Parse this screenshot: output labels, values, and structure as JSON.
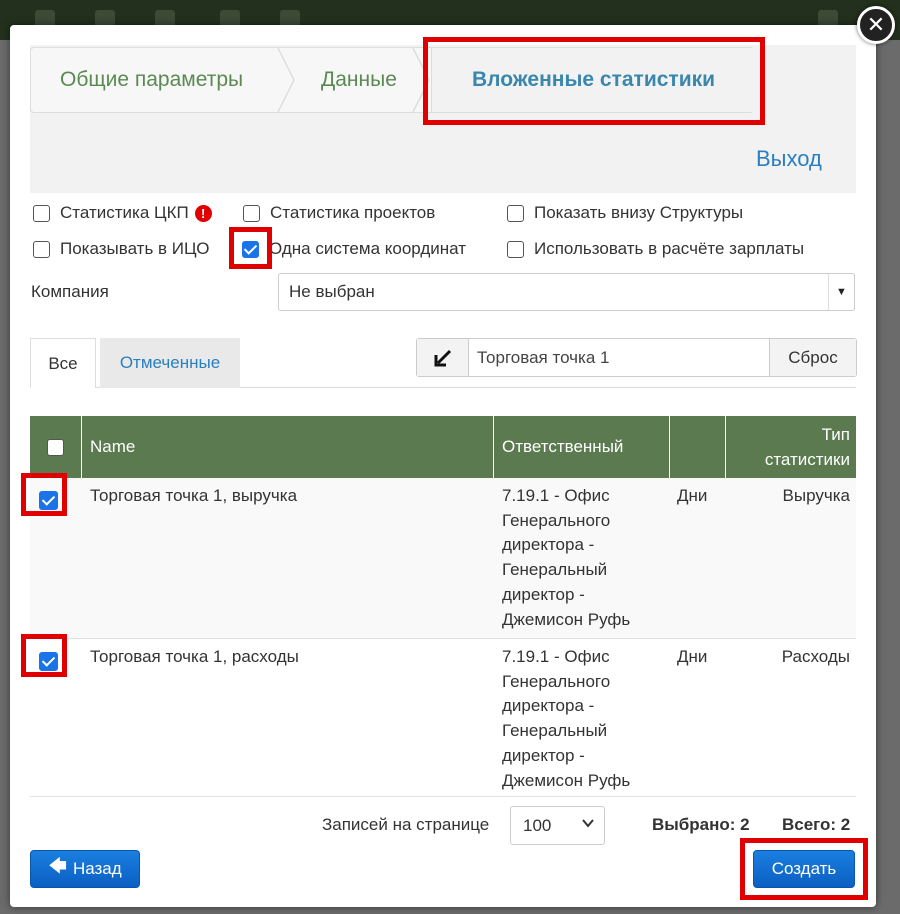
{
  "wizard": {
    "steps": [
      {
        "label": "Общие параметры"
      },
      {
        "label": "Данные"
      },
      {
        "label": "Вложенные статистики"
      }
    ],
    "exit_label": "Выход"
  },
  "options": {
    "stat_ckp": {
      "label": "Статистика ЦКП",
      "checked": false
    },
    "stat_projects": {
      "label": "Статистика проектов",
      "checked": false
    },
    "show_structure": {
      "label": "Показать внизу Структуры",
      "checked": false
    },
    "show_ico": {
      "label": "Показывать в ИЦО",
      "checked": false
    },
    "one_coords": {
      "label": "Одна система координат",
      "checked": true
    },
    "use_salary": {
      "label": "Использовать в расчёте зарплаты",
      "checked": false
    }
  },
  "company": {
    "label": "Компания",
    "value": "Не выбран"
  },
  "tabs": [
    {
      "label": "Все",
      "active": true
    },
    {
      "label": "Отмеченные",
      "active": false
    }
  ],
  "search": {
    "value": "Торговая точка 1",
    "reset_label": "Сброс"
  },
  "table": {
    "headers": {
      "name": "Name",
      "responsible": "Ответственный",
      "type_line1": "Тип",
      "type_line2": "статистики"
    },
    "rows": [
      {
        "name": "Торговая точка 1, выручка",
        "responsible": [
          "7.19.1 - Офис",
          "Генерального",
          "директора -",
          "Генеральный",
          "директор -",
          "Джемисон Руфь"
        ],
        "period": "Дни",
        "type": "Выручка",
        "checked": true
      },
      {
        "name": "Торговая точка 1, расходы",
        "responsible": [
          "7.19.1 - Офис",
          "Генерального",
          "директора -",
          "Генеральный",
          "директор -",
          "Джемисон Руфь"
        ],
        "period": "Дни",
        "type": "Расходы",
        "checked": true
      }
    ]
  },
  "footer": {
    "per_page_label": "Записей на странице",
    "per_page_value": "100",
    "selected_text": "Выбрано: 2",
    "total_text": "Всего: 2",
    "back_label": "Назад",
    "create_label": "Создать"
  },
  "icons": {
    "close": "close-icon",
    "warning": "exclamation-circle-icon",
    "arrow": "arrow-down-left-icon",
    "back_arrow": "arrow-left-icon",
    "caret": "caret-down-icon"
  },
  "colors": {
    "table_header": "#5b7a4f",
    "primary_button": "#0b6fd4",
    "active_step": "#3a87ad",
    "highlight": "#e00000"
  }
}
